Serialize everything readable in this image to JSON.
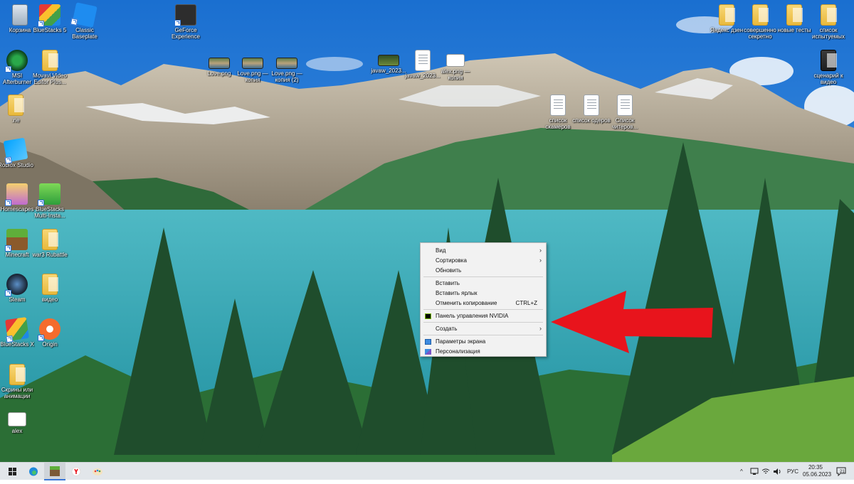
{
  "desktop": {
    "icons": [
      {
        "label": "Корзина"
      },
      {
        "label": "BlueStacks 5"
      },
      {
        "label": "Classic Baseplate"
      },
      {
        "label": "GeForce Experience"
      },
      {
        "label": "MSI Afterburner"
      },
      {
        "label": "Movavi Video Editor Plus..."
      },
      {
        "label": ".ne"
      },
      {
        "label": "Roblox Studio"
      },
      {
        "label": "Homescapes"
      },
      {
        "label": "BlueStacks Multi-Insta..."
      },
      {
        "label": "Minecraft"
      },
      {
        "label": "war3 Rubattle"
      },
      {
        "label": "Steam"
      },
      {
        "label": "видео"
      },
      {
        "label": "BlueStacks X"
      },
      {
        "label": "Origin"
      },
      {
        "label": "Скрины или анимации"
      },
      {
        "label": "alex"
      },
      {
        "label": "Love.png"
      },
      {
        "label": "Love.png — копия"
      },
      {
        "label": "Love.png — копия (2)"
      },
      {
        "label": "javaw_2023..."
      },
      {
        "label": "javaw_2023..."
      },
      {
        "label": "alex.png — копия"
      },
      {
        "label": "список скамеров"
      },
      {
        "label": "список одеров"
      },
      {
        "label": "Список читеров..."
      },
      {
        "label": "Яндекс дзен"
      },
      {
        "label": "совершенно секретно"
      },
      {
        "label": "новые тесты"
      },
      {
        "label": "список испытуемых"
      },
      {
        "label": "сценарий к видео"
      }
    ]
  },
  "context_menu": {
    "view": "Вид",
    "sort": "Сортировка",
    "refresh": "Обновить",
    "paste": "Вставить",
    "paste_shortcut": "Вставить ярлык",
    "undo_copy": "Отменить копирование",
    "undo_copy_key": "CTRL+Z",
    "nvidia": "Панель управления NVIDIA",
    "create": "Создать",
    "display_settings": "Параметры экрана",
    "personalize": "Персонализация",
    "submenu_glyph": "›"
  },
  "taskbar": {
    "language": "РУС",
    "time": "20:35",
    "date": "05.06.2023",
    "notification_count": "21",
    "tray_chevron": "^"
  },
  "colors": {
    "arrow": "#e8141c",
    "taskbar": "#e2e6ea",
    "menu_bg": "#f2f2f2"
  }
}
